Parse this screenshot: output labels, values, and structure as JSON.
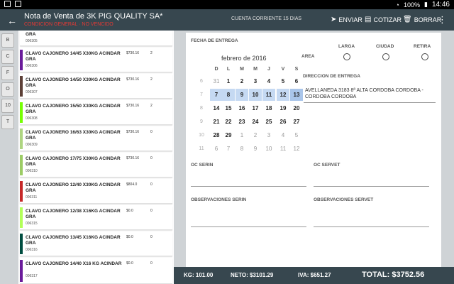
{
  "status": {
    "battery": "100%",
    "time": "14:46"
  },
  "header": {
    "title": "Nota de Venta de 3K PIG QUALITY SA*",
    "subtitle": "CONDICION GENERAL · NO VENCIDO",
    "account": "CUENTA CORRIENTE 15 DIAS",
    "send_label": "ENVIAR",
    "quote_label": "COTIZAR",
    "delete_label": "BORRAR"
  },
  "index_letters": [
    "B",
    "C",
    "F",
    "O",
    "10",
    "T"
  ],
  "products": [
    {
      "name": "GRA",
      "code": "006305",
      "price": "",
      "qty": "",
      "color": "#ffffff"
    },
    {
      "name": "CLAVO CAJONERO 14/45 X30KG ACINDAR GRA",
      "code": "006306",
      "price": "$730.16",
      "qty": "2",
      "color": "#6a1b9a"
    },
    {
      "name": "CLAVO CAJONERO 14/50 X30KG ACINDAR GRA",
      "code": "006307",
      "price": "$730.16",
      "qty": "2",
      "color": "#5d4037"
    },
    {
      "name": "CLAVO CAJONERO 15/50 X30KG ACINDAR GRA",
      "code": "006308",
      "price": "$730.16",
      "qty": "2",
      "color": "#76ff03"
    },
    {
      "name": "CLAVO CAJONERO 16/63 X30KG ACINDAR GRA",
      "code": "006309",
      "price": "$730.16",
      "qty": "0",
      "color": "#aed581"
    },
    {
      "name": "CLAVO CAJONERO 17/75 X30KG ACINDAR GRA",
      "code": "006310",
      "price": "$730.16",
      "qty": "0",
      "color": "#9ccc65"
    },
    {
      "name": "CLAVO CAJONERO 12/40 X30KG ACINDAR GRA",
      "code": "006311",
      "price": "$804.0",
      "qty": "0",
      "color": "#c62828"
    },
    {
      "name": "CLAVO CAJONERO 12/38 X16KG ACINDAR GRA",
      "code": "006315",
      "price": "$0.0",
      "qty": "0",
      "color": "#b2ff59"
    },
    {
      "name": "CLAVO CAJONERO 13/45 X16KG ACINDAR GRA",
      "code": "006316",
      "price": "$0.0",
      "qty": "0",
      "color": "#004d40"
    },
    {
      "name": "CLAVO CAJONERO 14/40 X16 KG ACINDAR",
      "code": "006317",
      "price": "$0.0",
      "qty": "0",
      "color": "#6a1b9a"
    }
  ],
  "form": {
    "delivery_date_label": "FECHA DE ENTREGA",
    "calendar": {
      "month": "febrero de 2016",
      "weekdays": [
        "D",
        "L",
        "M",
        "M",
        "J",
        "V",
        "S"
      ],
      "weeks": [
        {
          "week": "6",
          "days": [
            "31",
            "1",
            "2",
            "3",
            "4",
            "5",
            "6"
          ]
        },
        {
          "week": "7",
          "days": [
            "7",
            "8",
            "9",
            "10",
            "11",
            "12",
            "13"
          ]
        },
        {
          "week": "8",
          "days": [
            "14",
            "15",
            "16",
            "17",
            "18",
            "19",
            "20"
          ]
        },
        {
          "week": "9",
          "days": [
            "21",
            "22",
            "23",
            "24",
            "25",
            "26",
            "27"
          ]
        },
        {
          "week": "10",
          "days": [
            "28",
            "29",
            "1",
            "2",
            "3",
            "4",
            "5"
          ]
        },
        {
          "week": "11",
          "days": [
            "6",
            "7",
            "8",
            "9",
            "10",
            "11",
            "12"
          ]
        }
      ]
    },
    "area_label": "AREA",
    "area_options": [
      "LARGA",
      "CIUDAD",
      "RETIRA"
    ],
    "address_label": "DIRECCION DE ENTREGA",
    "address_value": "AVELLANEDA 3183 8ª ALTA CORDOBA CORDOBA - CORDOBA CORDOBA",
    "oc_serin_label": "OC SERIN",
    "oc_servet_label": "OC SERVET",
    "obs_serin_label": "OBSERVACIONES SERIN",
    "obs_servet_label": "OBSERVACIONES SERVET"
  },
  "totals": {
    "kg": "KG: 101.00",
    "neto": "NETO: $3101.29",
    "iva": "IVA: $651.27",
    "total": "TOTAL: $3752.56"
  }
}
